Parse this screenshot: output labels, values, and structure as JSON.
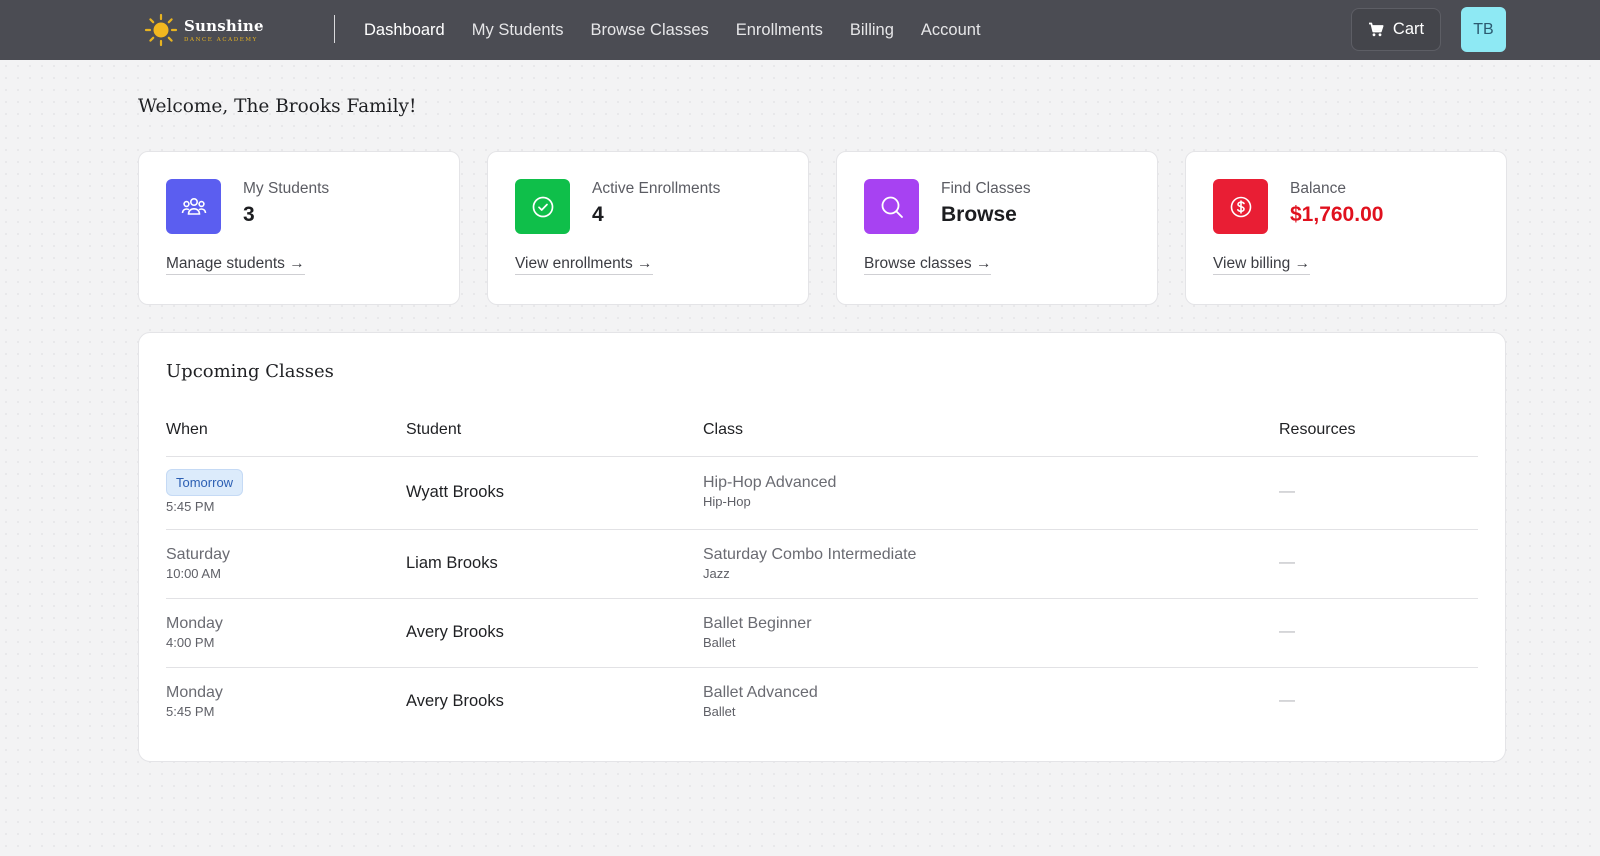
{
  "brand": {
    "name": "Sunshine",
    "subtitle": "DANCE ACADEMY",
    "accent_color": "#e7b321"
  },
  "nav": {
    "items": [
      {
        "label": "Dashboard",
        "active": true
      },
      {
        "label": "My Students",
        "active": false
      },
      {
        "label": "Browse Classes",
        "active": false
      },
      {
        "label": "Enrollments",
        "active": false
      },
      {
        "label": "Billing",
        "active": false
      },
      {
        "label": "Account",
        "active": false
      }
    ],
    "cart_label": "Cart",
    "cart_icon": "cart-icon",
    "avatar_initials": "TB"
  },
  "welcome": "Welcome, The Brooks Family!",
  "cards": [
    {
      "label": "My Students",
      "value": "3",
      "link": "Manage students →",
      "icon": "users-icon",
      "color": "#5b5ef0"
    },
    {
      "label": "Active Enrollments",
      "value": "4",
      "link": "View enrollments →",
      "icon": "check-circle-icon",
      "color": "#0fbf4a"
    },
    {
      "label": "Find Classes",
      "value": "Browse",
      "link": "Browse classes →",
      "icon": "search-icon",
      "color": "#a742f2"
    },
    {
      "label": "Balance",
      "value": "$1,760.00",
      "link": "View billing →",
      "icon": "dollar-circle-icon",
      "color": "#e91e34"
    }
  ],
  "upcoming": {
    "title": "Upcoming Classes",
    "headers": {
      "when": "When",
      "student": "Student",
      "class": "Class",
      "resources": "Resources"
    },
    "rows": [
      {
        "day": "Tomorrow",
        "time": "5:45 PM",
        "badge": true,
        "student": "Wyatt Brooks",
        "class": "Hip-Hop Advanced",
        "style": "Hip-Hop",
        "resources": "—"
      },
      {
        "day": "Saturday",
        "time": "10:00 AM",
        "badge": false,
        "student": "Liam Brooks",
        "class": "Saturday Combo Intermediate",
        "style": "Jazz",
        "resources": "—"
      },
      {
        "day": "Monday",
        "time": "4:00 PM",
        "badge": false,
        "student": "Avery Brooks",
        "class": "Ballet Beginner",
        "style": "Ballet",
        "resources": "—"
      },
      {
        "day": "Monday",
        "time": "5:45 PM",
        "badge": false,
        "student": "Avery Brooks",
        "class": "Ballet Advanced",
        "style": "Ballet",
        "resources": "—"
      }
    ]
  }
}
